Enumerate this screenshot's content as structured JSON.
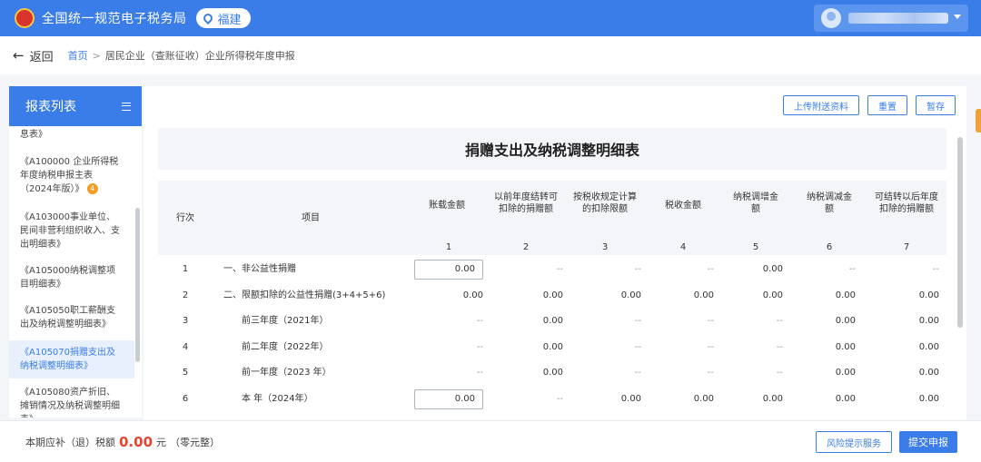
{
  "header": {
    "site_title": "全国统一规范电子税务局",
    "region": "福建",
    "brand_color": "#3a7de8"
  },
  "nav": {
    "back_label": "返回",
    "breadcrumb": [
      "首页",
      "居民企业（查账征收）企业所得税年度申报"
    ]
  },
  "sidebar": {
    "title": "报表列表",
    "items": [
      {
        "label": "息表》",
        "active": false
      },
      {
        "label": "《A100000 企业所得税年度纳税申报主表（2024年版）》",
        "badge": "4",
        "active": false
      },
      {
        "label": "《A103000事业单位、民间非营利组织收入、支出明细表》",
        "active": false
      },
      {
        "label": "《A105000纳税调整项目明细表》",
        "active": false
      },
      {
        "label": "《A105050职工薪酬支出及纳税调整明细表》",
        "active": false
      },
      {
        "label": "《A105070捐赠支出及纳税调整明细表》",
        "active": true
      },
      {
        "label": "《A105080资产折旧、摊销情况及纳税调整明细表》",
        "active": false
      }
    ]
  },
  "toolbar": {
    "upload_label": "上传附送资料",
    "reset_label": "重置",
    "save_label": "暂存"
  },
  "form": {
    "title": "捐赠支出及纳税调整明细表",
    "columns": {
      "row_no": "行次",
      "item": "项目",
      "c1": "账载金额",
      "c2": "以前年度结转可扣除的捐赠额",
      "c3": "按税收规定计算的扣除限额",
      "c4": "税收金额",
      "c5": "纳税调增金额",
      "c6": "纳税调减金额",
      "c7": "可结转以后年度扣除的捐赠额"
    },
    "column_numbers": [
      "1",
      "2",
      "3",
      "4",
      "5",
      "6",
      "7"
    ],
    "rows": [
      {
        "no": "1",
        "item": "一、非公益性捐赠",
        "values": [
          "0.00",
          "--",
          "--",
          "--",
          "0.00",
          "--",
          "--"
        ],
        "editable_first": true
      },
      {
        "no": "2",
        "item": "二、限额扣除的公益性捐赠(3+4+5+6)",
        "values": [
          "0.00",
          "0.00",
          "0.00",
          "0.00",
          "0.00",
          "0.00",
          "0.00"
        ],
        "editable_first": false
      },
      {
        "no": "3",
        "item": "前三年度（2021年）",
        "values": [
          "--",
          "0.00",
          "--",
          "--",
          "--",
          "0.00",
          "0.00"
        ],
        "editable_first": false
      },
      {
        "no": "4",
        "item": "前二年度（2022年）",
        "values": [
          "--",
          "0.00",
          "--",
          "--",
          "--",
          "0.00",
          "0.00"
        ],
        "editable_first": false
      },
      {
        "no": "5",
        "item": "前一年度（2023 年）",
        "values": [
          "--",
          "0.00",
          "--",
          "--",
          "--",
          "0.00",
          "0.00"
        ],
        "editable_first": false
      },
      {
        "no": "6",
        "item": "本 年（2024年）",
        "values": [
          "0.00",
          "--",
          "0.00",
          "0.00",
          "0.00",
          "0.00",
          "0.00"
        ],
        "editable_first": true
      }
    ]
  },
  "footer": {
    "label": "本期应补（退）税额",
    "amount": "0.00",
    "unit": "元",
    "amount_words": "（零元整）",
    "risk_button": "风险提示服务",
    "submit_button": "提交申报",
    "amount_color": "#e8432f"
  }
}
